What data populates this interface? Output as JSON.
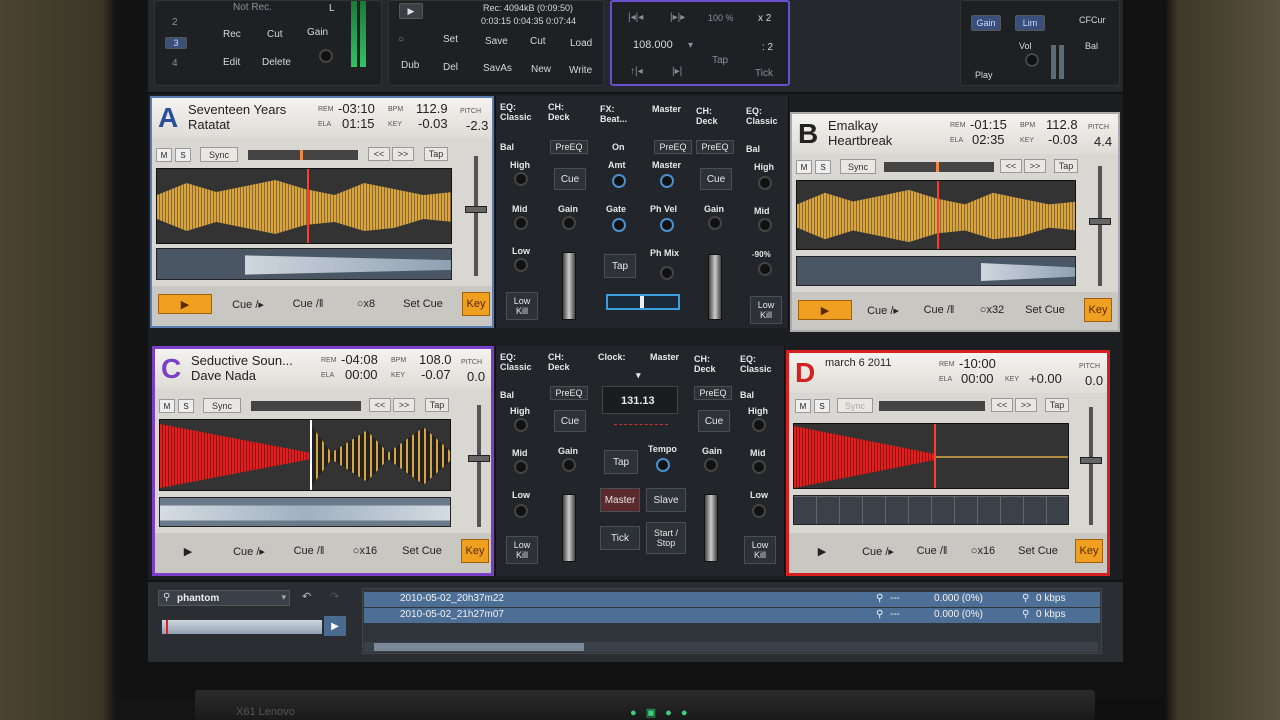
{
  "topbar": {
    "recorder": {
      "not_rec": "Not Rec.",
      "l": "L",
      "rec": "Rec",
      "cut": "Cut",
      "gain": "Gain",
      "edit": "Edit",
      "delete": "Delete",
      "slots": [
        "2",
        "3",
        "4"
      ]
    },
    "loop_recorder": {
      "rec_info": "Rec: 4094kB (0:09:50)",
      "times": "0:03:15 0:04:35 0:07:44",
      "set": "Set",
      "save": "Save",
      "cut": "Cut",
      "load": "Load",
      "dub": "Dub",
      "del": "Del",
      "save_as": "SavAs",
      "new": "New",
      "write": "Write"
    },
    "master_clock": {
      "pct": "100 %",
      "x2": "x 2",
      "bpm": "108.000",
      "div2": ": 2",
      "tap": "Tap",
      "tick": "Tick"
    },
    "master": {
      "gain": "Gain",
      "lim": "Lim",
      "cfcurve": "CFCur",
      "vol": "Vol",
      "bal": "Bal",
      "play": "Play"
    }
  },
  "deck_a": {
    "letter": "A",
    "title": "Seventeen Years",
    "artist": "Ratatat",
    "rem_label": "REM",
    "rem": "-03:10",
    "bpm_label": "BPM",
    "bpm": "112.9",
    "ela_label": "ELA",
    "ela": "01:15",
    "key_label": "KEY",
    "key_val": "-0.03",
    "pitch_label": "PITCH",
    "pitch": "-2.3",
    "m": "M",
    "s": "S",
    "sync": "Sync",
    "back": "<<",
    "fwd": ">>",
    "tap": "Tap",
    "cue_play": "Cue /▸",
    "cue_pause": "Cue /‖",
    "loop": "○x8",
    "set_cue": "Set Cue",
    "key": "Key"
  },
  "deck_b": {
    "letter": "B",
    "title": "Emalkay",
    "artist": "Heartbreak",
    "rem_label": "REM",
    "rem": "-01:15",
    "bpm_label": "BPM",
    "bpm": "112.8",
    "ela_label": "ELA",
    "ela": "02:35",
    "key_label": "KEY",
    "key_val": "-0.03",
    "pitch_label": "PITCH",
    "pitch": "4.4",
    "m": "M",
    "s": "S",
    "sync": "Sync",
    "back": "<<",
    "fwd": ">>",
    "tap": "Tap",
    "cue_play": "Cue /▸",
    "cue_pause": "Cue /‖",
    "loop": "○x32",
    "set_cue": "Set Cue",
    "key": "Key"
  },
  "deck_c": {
    "letter": "C",
    "title": "Seductive Soun...",
    "artist": "Dave Nada",
    "rem_label": "REM",
    "rem": "-04:08",
    "bpm_label": "BPM",
    "bpm": "108.0",
    "ela_label": "ELA",
    "ela": "00:00",
    "key_label": "KEY",
    "key_val": "-0.07",
    "pitch_label": "PITCH",
    "pitch": "0.0",
    "m": "M",
    "s": "S",
    "sync": "Sync",
    "back": "<<",
    "fwd": ">>",
    "tap": "Tap",
    "cue_play": "Cue /▸",
    "cue_pause": "Cue /‖",
    "loop": "○x16",
    "set_cue": "Set Cue",
    "key": "Key"
  },
  "deck_d": {
    "letter": "D",
    "title": "march 6 2011",
    "artist": "",
    "rem_label": "REM",
    "rem": "-10:00",
    "bpm_label": "BPM",
    "bpm": "",
    "ela_label": "ELA",
    "ela": "00:00",
    "key_label": "KEY",
    "key_val": "+0.00",
    "pitch_label": "PITCH",
    "pitch": "0.0",
    "m": "M",
    "s": "S",
    "sync": "Sync",
    "back": "<<",
    "fwd": ">>",
    "tap": "Tap",
    "cue_play": "Cue /▸",
    "cue_pause": "Cue /‖",
    "loop": "○x16",
    "set_cue": "Set Cue",
    "key": "Key"
  },
  "mixer_top": {
    "eq_left": "EQ:",
    "eq_left_type": "Classic",
    "ch_left": "CH:",
    "ch_left_src": "Deck",
    "fx": "FX:",
    "fx_name": "Beat...",
    "master": "Master",
    "ch_right": "CH:",
    "ch_right_src": "Deck",
    "eq_right": "EQ:",
    "eq_right_type": "Classic",
    "bal": "Bal",
    "high": "High",
    "mid": "Mid",
    "low": "Low",
    "low_kill": "Low Kill",
    "preeq": "PreEQ",
    "cue": "Cue",
    "gain": "Gain",
    "on": "On",
    "amt": "Amt",
    "master2": "Master",
    "gate": "Gate",
    "ph_vel": "Ph Vel",
    "tap": "Tap",
    "ph_mix": "Ph Mix",
    "minus90": "-90%"
  },
  "mixer_bottom": {
    "clock": "Clock:",
    "master": "Master",
    "bpm": "131.13",
    "tap": "Tap",
    "tempo": "Tempo",
    "master_btn": "Master",
    "slave": "Slave",
    "tick": "Tick",
    "start_stop": "Start / Stop"
  },
  "browser": {
    "search": "phantom",
    "rows": [
      {
        "name": "2010-05-02_20h37m22",
        "dash": "---",
        "gain": "0.000 (0%)",
        "kbps": "0 kbps"
      },
      {
        "name": "2010-05-02_21h27m07",
        "dash": "---",
        "gain": "0.000 (0%)",
        "kbps": "0 kbps"
      }
    ]
  },
  "laptop": {
    "brand": "X61 Lenovo"
  },
  "colors": {
    "deck_a": "#2a4f9a",
    "deck_b": "#222222",
    "deck_c": "#7a3fc8",
    "deck_d": "#d42020",
    "accent": "#f0a020"
  }
}
